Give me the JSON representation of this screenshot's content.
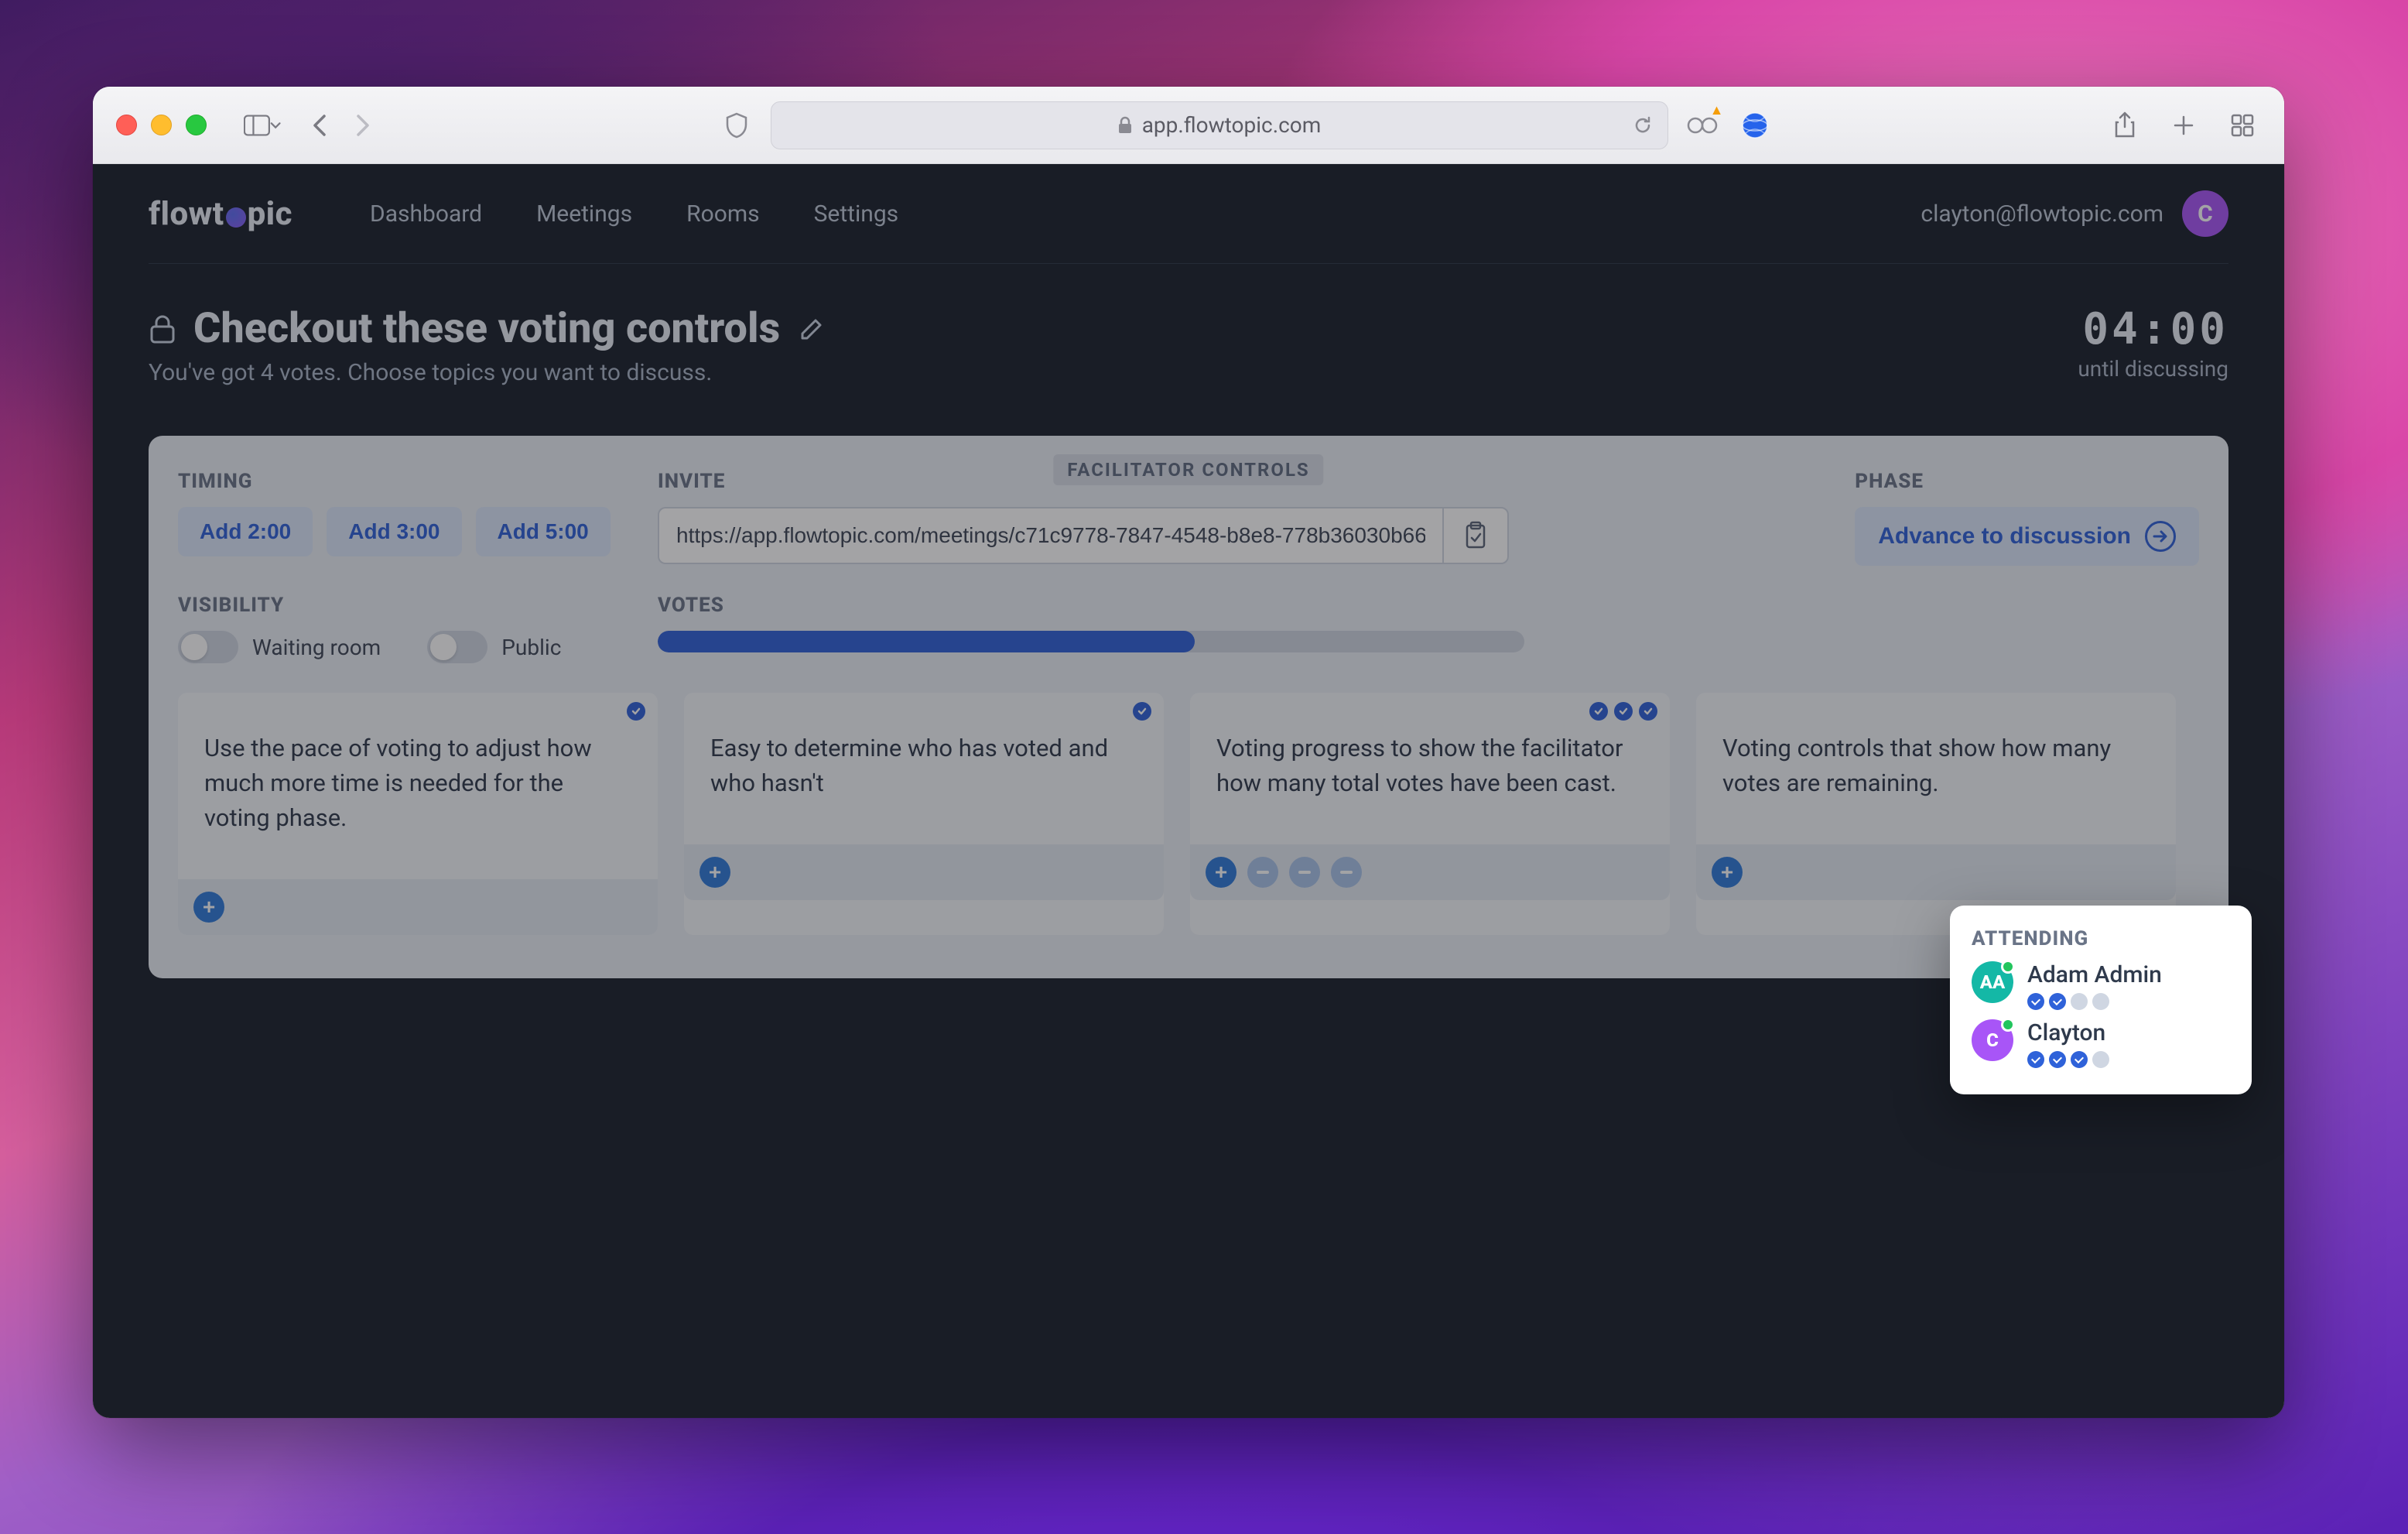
{
  "browser": {
    "url_host": "app.flowtopic.com"
  },
  "app": {
    "brand_left": "flowt",
    "brand_right": "pic",
    "nav": [
      "Dashboard",
      "Meetings",
      "Rooms",
      "Settings"
    ],
    "user_email": "clayton@flowtopic.com",
    "user_initial": "C"
  },
  "title": {
    "text": "Checkout these voting controls",
    "subtitle": "You've got 4 votes. Choose topics you want to discuss."
  },
  "timer": {
    "value": "04:00",
    "label": "until discussing"
  },
  "facilitator": {
    "badge": "FACILITATOR CONTROLS",
    "timing_label": "TIMING",
    "timing_buttons": [
      "Add 2:00",
      "Add 3:00",
      "Add 5:00"
    ],
    "invite_label": "INVITE",
    "invite_url": "https://app.flowtopic.com/meetings/c71c9778-7847-4548-b8e8-778b36030b66",
    "phase_label": "PHASE",
    "phase_button": "Advance to discussion",
    "visibility_label": "VISIBILITY",
    "visibility_waiting": "Waiting room",
    "visibility_public": "Public",
    "votes_label": "VOTES",
    "votes_percent": 62
  },
  "cards": [
    {
      "text": "Use the pace of voting to adjust how much more time is needed for the voting phase.",
      "votes": 1,
      "removers": 0
    },
    {
      "text": "Easy to determine who has voted and who hasn't",
      "votes": 1,
      "removers": 0
    },
    {
      "text": "Voting progress to show the facilitator how many total votes have been cast.",
      "votes": 3,
      "removers": 3
    },
    {
      "text": "Voting controls that show how many votes are remaining.",
      "votes": 0,
      "removers": 0
    }
  ],
  "attending": {
    "label": "ATTENDING",
    "people": [
      {
        "name": "Adam Admin",
        "initials": "AA",
        "color": "teal",
        "used": 2,
        "total": 4
      },
      {
        "name": "Clayton",
        "initials": "C",
        "color": "purple",
        "used": 3,
        "total": 4
      }
    ]
  },
  "colors": {
    "accent": "#2f62d9"
  }
}
